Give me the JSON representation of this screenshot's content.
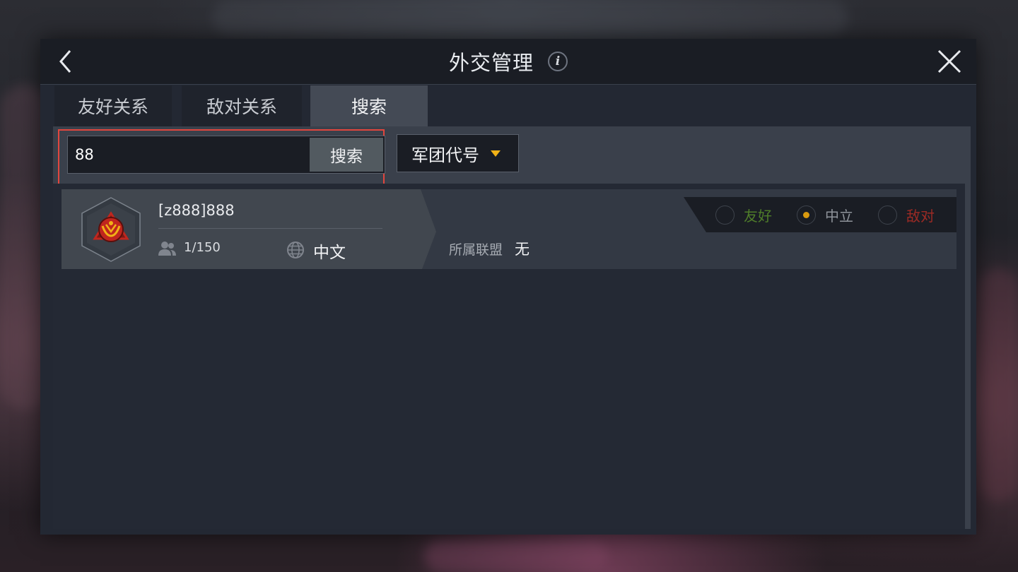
{
  "header": {
    "title": "外交管理",
    "info_icon": "i"
  },
  "tabs": [
    {
      "label": "友好关系",
      "active": false
    },
    {
      "label": "敌对关系",
      "active": false
    },
    {
      "label": "搜索",
      "active": true
    }
  ],
  "search": {
    "value": "88",
    "button_label": "搜索",
    "type_select": "军团代号"
  },
  "results": [
    {
      "name": "[z888]888",
      "members": "1/150",
      "language": "中文",
      "alliance_label": "所属联盟",
      "alliance_value": "无",
      "relations": [
        {
          "label": "友好",
          "color": "#4f7d2a",
          "selected": false
        },
        {
          "label": "中立",
          "color": "#8f949b",
          "selected": true
        },
        {
          "label": "敌对",
          "color": "#9c2a24",
          "selected": false
        }
      ]
    }
  ],
  "colors": {
    "accent": "#f1b216",
    "highlight": "#e2463e",
    "emblem": "#c0261e"
  }
}
